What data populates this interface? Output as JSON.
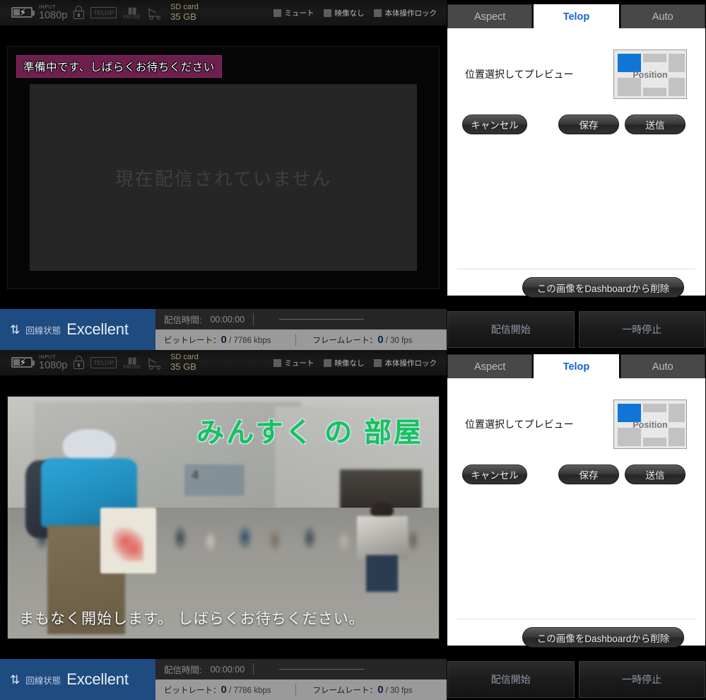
{
  "device_bar": {
    "battery_icon": "battery-bolt-icon",
    "input_small_label": "INPUT",
    "input_value": "1080p",
    "lock_icon": "lock-icon",
    "telop_icon_label": "TELOP",
    "pause_icon_label": "PAUSE",
    "cut_icon": "scissors-cut-icon",
    "sd_label": "SD card",
    "sd_value": "35 GB",
    "checkboxes": [
      {
        "label": "ミュート",
        "checked": false
      },
      {
        "label": "映像なし",
        "checked": false
      },
      {
        "label": "本体操作ロック",
        "checked": false
      }
    ]
  },
  "preview_idle": {
    "telop_text": "準備中です、しばらくお待ちください",
    "no_stream_text": "現在配信されていません",
    "telop_bg_color": "#6d1f4d"
  },
  "preview_live": {
    "title_text": "みんすく の 部屋",
    "subtitle_text": "まもなく開始します。 しばらくお待ちください。",
    "title_color": "#13c45a"
  },
  "status_bar": {
    "line_state_label": "回線状態",
    "line_state_value": "Excellent",
    "line_state_bg": "#1e4b80",
    "arrows_icon": "up-down-arrows-icon",
    "stream_time_label": "配信時間:",
    "stream_time_value": "00:00:00",
    "bitrate_label": "ビットレート：",
    "bitrate_value": "0",
    "bitrate_sep": "/",
    "bitrate_max": "7786 kbps",
    "framerate_label": "フレームレート：",
    "framerate_value": "0",
    "framerate_sep": "/",
    "framerate_max": "30 fps"
  },
  "right_panel": {
    "tabs": [
      {
        "label": "Aspect",
        "active": false
      },
      {
        "label": "Telop",
        "active": true
      },
      {
        "label": "Auto",
        "active": false
      }
    ],
    "active_tab_color": "#1565d8",
    "telop_pane": {
      "position_instruction": "位置選択してプレビュー",
      "position_widget_label": "Position",
      "selected_cell": "top-left",
      "selected_color": "#1175d6",
      "buttons": {
        "cancel": "キャンセル",
        "save": "保存",
        "send": "送信",
        "delete": "この画像をDashboardから削除"
      }
    },
    "actions": {
      "start": "配信開始",
      "pause": "一時停止"
    }
  }
}
